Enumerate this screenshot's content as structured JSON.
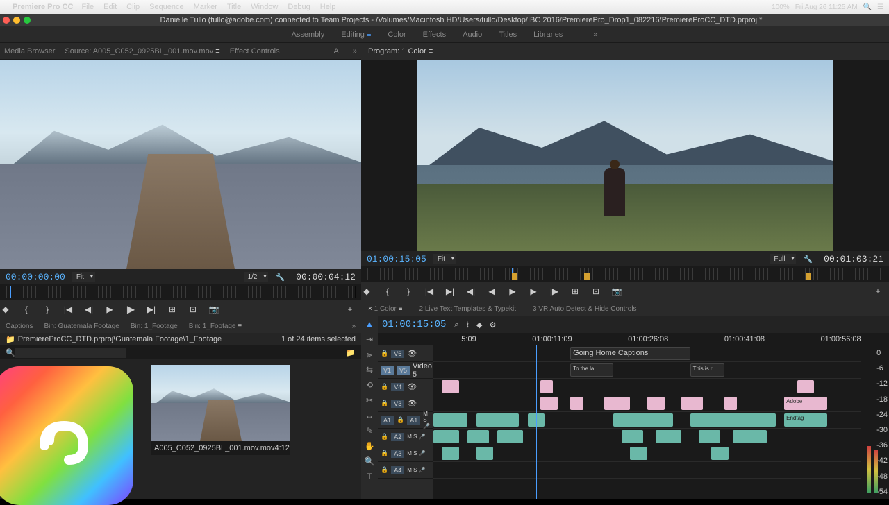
{
  "menubar": {
    "app": "Premiere Pro CC",
    "items": [
      "File",
      "Edit",
      "Clip",
      "Sequence",
      "Marker",
      "Title",
      "Window",
      "Debug",
      "Help"
    ],
    "right": {
      "battery": "100%",
      "datetime": "Fri Aug 26  11:25 AM"
    }
  },
  "titlebar": "Danielle Tullo (tullo@adobe.com) connected to Team Projects - /Volumes/Macintosh HD/Users/tullo/Desktop/IBC 2016/PremierePro_Drop1_082216/PremiereProCC_DTD.prproj *",
  "workspaces": {
    "items": [
      "Assembly",
      "Editing",
      "Color",
      "Effects",
      "Audio",
      "Titles",
      "Libraries"
    ],
    "active": "Editing"
  },
  "source_panel": {
    "tabs": {
      "items": [
        "Media Browser",
        "Source: A005_C052_0925BL_001.mov.mov",
        "Effect Controls"
      ],
      "active": 1,
      "extra": "A"
    },
    "tc_in": "00:00:00:00",
    "fit": "Fit",
    "res": "1/2",
    "tc_dur": "00:00:04:12"
  },
  "program_panel": {
    "title": "Program: 1 Color",
    "tc_in": "01:00:15:05",
    "fit": "Fit",
    "quality": "Full",
    "tc_dur": "00:01:03:21"
  },
  "transport_icons": [
    "◆",
    "{",
    "}",
    "|◀",
    "◀|",
    "▶",
    "|▶",
    "▶|",
    "⊞",
    "⊡",
    "📷"
  ],
  "project_panel": {
    "tabs": {
      "items": [
        "Captions",
        "Bin: Guatemala Footage",
        "Bin: 1_Footage",
        "Bin: 1_Footage"
      ],
      "active": 3
    },
    "path": "PremiereProCC_DTD.prproj\\Guatemala Footage\\1_Footage",
    "count": "1 of 24 items selected",
    "search_placeholder": "",
    "thumb": {
      "name": "A005_C052_0925BL_001.mov.mov",
      "dur": "4:12"
    }
  },
  "timeline": {
    "tabs": {
      "items": [
        "1 Color",
        "2 Live Text Templates & Typekit",
        "3 VR Auto Detect & Hide Controls"
      ],
      "active": 0
    },
    "tc": "01:00:15:05",
    "ruler": [
      "5:09",
      "01:00:11:09",
      "01:00:26:08",
      "01:00:41:08",
      "01:00:56:08"
    ],
    "video_tracks": [
      {
        "lbl": "V6",
        "name": "",
        "sel": false
      },
      {
        "lbl": "V5",
        "name": "Video 5",
        "sel": true
      },
      {
        "lbl": "V4",
        "name": "",
        "sel": false
      },
      {
        "lbl": "V3",
        "name": "",
        "sel": false
      }
    ],
    "v1": "V1",
    "audio_tracks": [
      {
        "lbl": "A1",
        "a": "A1"
      },
      {
        "lbl": "A2",
        "a": ""
      },
      {
        "lbl": "A3",
        "a": ""
      },
      {
        "lbl": "A4",
        "a": ""
      }
    ],
    "captions": {
      "title": "Going Home Captions",
      "c1": "To the la",
      "c2": "This is r"
    },
    "adobe_clip": "Adobe",
    "endtag": "Endtag"
  },
  "meter_labels": [
    "0",
    "-6",
    "-12",
    "-18",
    "-24",
    "-30",
    "-36",
    "-42",
    "-48",
    "-54"
  ]
}
